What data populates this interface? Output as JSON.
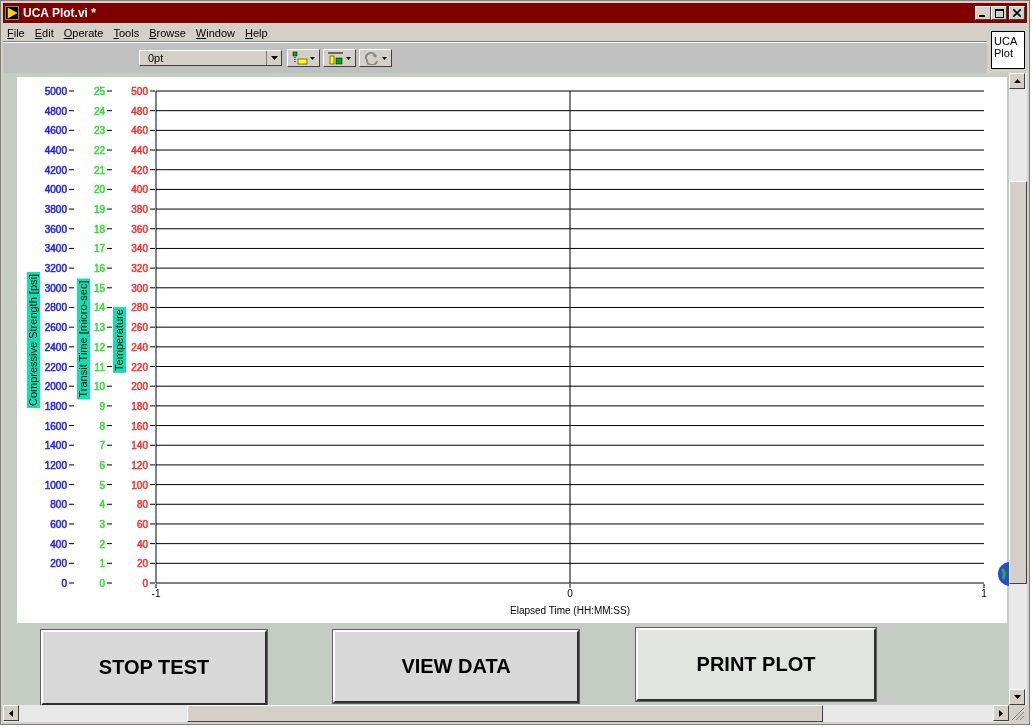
{
  "window": {
    "title": "UCA Plot.vi *"
  },
  "menu": [
    "File",
    "Edit",
    "Operate",
    "Tools",
    "Browse",
    "Window",
    "Help"
  ],
  "toolbar": {
    "font_dropdown": "0pt"
  },
  "vi_label": "UCA Plot",
  "plot": {
    "y_axes": [
      {
        "title": "Compressive Strength [psi]",
        "color": "#2020ff",
        "ticks": [
          "5000",
          "4800",
          "4600",
          "4400",
          "4200",
          "4000",
          "3800",
          "3600",
          "3400",
          "3200",
          "3000",
          "2800",
          "2600",
          "2400",
          "2200",
          "2000",
          "1800",
          "1600",
          "1400",
          "1200",
          "1000",
          "800",
          "600",
          "400",
          "200",
          "0"
        ]
      },
      {
        "title": "Transit Time [micro-sec]",
        "color": "#30e030",
        "ticks": [
          "25",
          "24",
          "23",
          "22",
          "21",
          "20",
          "19",
          "18",
          "17",
          "16",
          "15",
          "14",
          "13",
          "12",
          "11",
          "10",
          "9",
          "8",
          "7",
          "6",
          "5",
          "4",
          "3",
          "2",
          "1",
          "0"
        ]
      },
      {
        "title": "Temperature",
        "color": "#ff3030",
        "ticks": [
          "500",
          "480",
          "460",
          "440",
          "420",
          "400",
          "380",
          "360",
          "340",
          "320",
          "300",
          "280",
          "260",
          "240",
          "220",
          "200",
          "180",
          "160",
          "140",
          "120",
          "100",
          "80",
          "60",
          "40",
          "20",
          "0"
        ]
      }
    ],
    "x_axis": {
      "title": "Elapsed Time (HH:MM:SS)",
      "ticks": [
        "-1",
        "0",
        "1"
      ]
    }
  },
  "buttons": [
    "STOP TEST",
    "VIEW DATA",
    "PRINT PLOT"
  ]
}
